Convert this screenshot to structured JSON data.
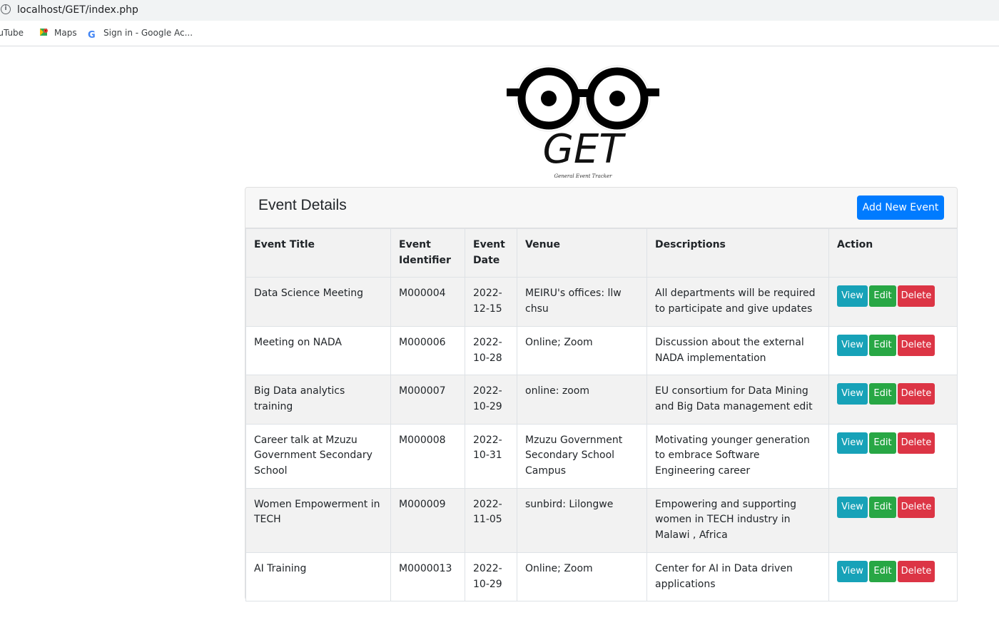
{
  "browser": {
    "url": "localhost/GET/index.php",
    "bookmarks": [
      {
        "label": "ouTube",
        "icon": "youtube-icon"
      },
      {
        "label": "Maps",
        "icon": "google-maps-icon"
      },
      {
        "label": "Sign in - Google Ac...",
        "icon": "google-icon"
      }
    ]
  },
  "logo": {
    "text": "GET",
    "tagline": "General Event Tracker"
  },
  "card": {
    "title": "Event Details",
    "add_button": "Add New Event"
  },
  "table": {
    "headers": [
      "Event Title",
      "Event Identifier",
      "Event Date",
      "Venue",
      "Descriptions",
      "Action"
    ],
    "rows": [
      {
        "title": "Data Science Meeting",
        "id": "M000004",
        "date": "2022-12-15",
        "venue": "MEIRU's offices: llw chsu",
        "description": "All departments will be required to participate and give updates"
      },
      {
        "title": "Meeting on NADA",
        "id": "M000006",
        "date": "2022-10-28",
        "venue": "Online; Zoom",
        "description": "Discussion about the external NADA implementation"
      },
      {
        "title": "Big Data analytics training",
        "id": "M000007",
        "date": "2022-10-29",
        "venue": "online: zoom",
        "description": "EU consortium for Data Mining and Big Data management edit"
      },
      {
        "title": "Career talk at Mzuzu Government Secondary School",
        "id": "M000008",
        "date": "2022-10-31",
        "venue": "Mzuzu Government Secondary School Campus",
        "description": "Motivating younger generation to embrace Software Engineering career"
      },
      {
        "title": "Women Empowerment in TECH",
        "id": "M000009",
        "date": "2022-11-05",
        "venue": "sunbird: Lilongwe",
        "description": "Empowering and supporting women in TECH industry in Malawi , Africa"
      },
      {
        "title": "AI Training",
        "id": "M0000013",
        "date": "2022-10-29",
        "venue": "Online; Zoom",
        "description": "Center for AI in Data driven applications"
      }
    ],
    "actions": {
      "view": "View",
      "edit": "Edit",
      "delete": "Delete"
    }
  },
  "colors": {
    "primary": "#007bff",
    "info": "#17a2b8",
    "success": "#28a745",
    "danger": "#dc3545"
  }
}
